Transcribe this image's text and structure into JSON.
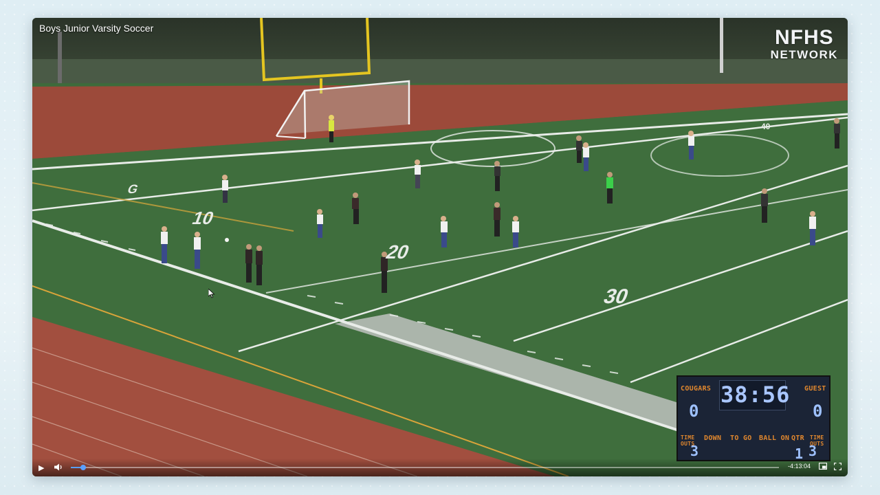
{
  "video": {
    "title": "Boys Junior Varsity Soccer",
    "logo_top": "NFHS",
    "logo_bottom": "NETWORK"
  },
  "field": {
    "yard_numbers": [
      "10",
      "20",
      "30"
    ],
    "far_numbers": [
      "G",
      "40"
    ]
  },
  "scoreboard": {
    "home_label": "COUGARS",
    "guest_label": "GUEST",
    "clock": "38:56",
    "home_score": "0",
    "guest_score": "0",
    "home_timeouts_label": "TIME OUTS",
    "down_label": "DOWN",
    "to_go_label": "TO GO",
    "ball_on_label": "BALL ON",
    "qtr_label": "QTR",
    "guest_timeouts_label": "TIME OUTS",
    "home_timeouts": "3",
    "qtr": "1",
    "guest_timeouts": "3"
  },
  "controls": {
    "play_icon": "play-icon",
    "volume_icon": "volume-icon",
    "pip_icon": "picture-in-picture-icon",
    "fullscreen_icon": "fullscreen-icon",
    "time_remaining": "-4:13:04",
    "progress_fraction": 0.017
  }
}
